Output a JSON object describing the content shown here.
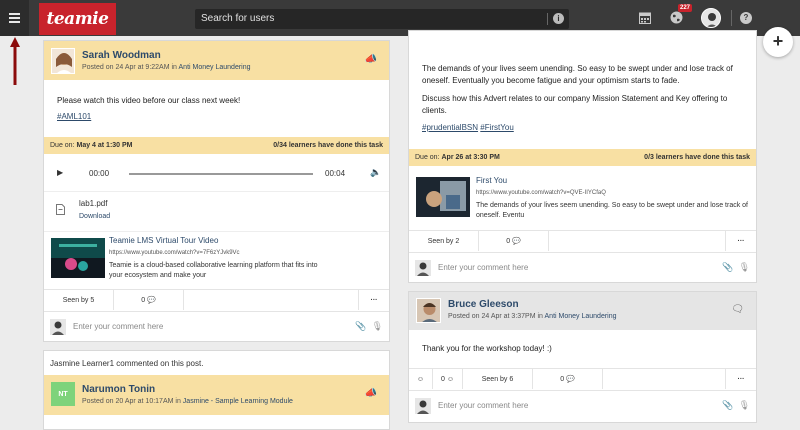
{
  "search": {
    "placeholder": "Search for users"
  },
  "header": {
    "logo_text": "teamie",
    "notification_count": "227"
  },
  "fab": {
    "label": "+"
  },
  "post1": {
    "author": "Sarah Woodman",
    "posted_prefix": "Posted on 24 Apr at 9:22AM in ",
    "group": "Anti Money Laundering",
    "message": "Please watch this video before our class next week!",
    "tag": "#AML101",
    "due_label": "Due on:",
    "due_date": "May 4 at 1:30 PM",
    "progress": "0/34 learners have done this task",
    "audio_start": "00:00",
    "audio_end": "00:04",
    "file_name": "lab1.pdf",
    "file_action": "Download",
    "link_title": "Teamie LMS Virtual Tour Video",
    "link_url": "https://www.youtube.com/watch?v=7F6zYJvk9Vc",
    "link_desc": "Teamie is a cloud-based collaborative learning platform that fits into your ecosystem and make your",
    "seen": "Seen by 5",
    "comments": "0",
    "comment_placeholder": "Enter your comment here"
  },
  "activity": {
    "text": "Jasmine Learner1 commented on this post."
  },
  "post3": {
    "author": "Narumon Tonin",
    "initials": "NT",
    "posted_prefix": "Posted on 20 Apr at 10:17AM in ",
    "group": "Jasmine - Sample Learning Module"
  },
  "post2": {
    "para1": "The demands of your lives seem unending. So easy to be swept under and lose track of oneself. Eventually you become fatigue and your optimism starts to fade.",
    "para2": "Discuss how this Advert relates to our company Mission Statement and Key offering to clients.",
    "tag1": "#prudentialBSN",
    "tag2": "#FirstYou",
    "due_label": "Due on:",
    "due_date": "Apr 26 at 3:30 PM",
    "progress": "0/3 learners have done this task",
    "link_title": "First You",
    "link_url": "https://www.youtube.com/watch?v=QVE-IIYCfaQ",
    "link_desc": "The demands of your lives seem unending. So easy to be swept under and lose track of oneself. Eventu",
    "seen": "Seen by 2",
    "comments": "0",
    "comment_placeholder": "Enter your comment here"
  },
  "post4": {
    "author": "Bruce Gleeson",
    "posted_prefix": "Posted on 24 Apr at 3:37PM in ",
    "group": "Anti Money Laundering",
    "message": "Thank you for the workshop today! :)",
    "reactions": "0",
    "seen": "Seen by 6",
    "comments": "0",
    "comment_placeholder": "Enter your comment here"
  }
}
